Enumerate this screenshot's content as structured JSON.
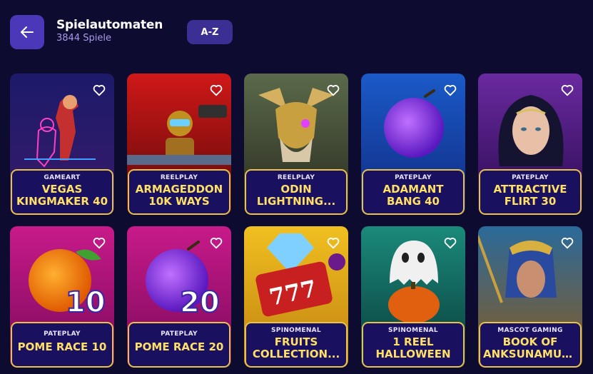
{
  "header": {
    "title": "Spielautomaten",
    "subtitle": "3844 Spiele",
    "sort_label": "A-Z",
    "back_icon": "arrow-left-icon"
  },
  "colors": {
    "background": "#0e0b30",
    "back_button": "#4a38b8",
    "sort_button": "#3b2f93",
    "label_border": "#e8c24a",
    "game_title": "#ffe066"
  },
  "games": [
    {
      "provider": "GAMEART",
      "line1": "VEGAS",
      "line2": "KINGMAKER 40",
      "art": "neon-couple"
    },
    {
      "provider": "REELPLAY",
      "line1": "ARMAGEDDON",
      "line2": "10K WAYS",
      "art": "robot"
    },
    {
      "provider": "REELPLAY",
      "line1": "ODIN",
      "line2": "LIGHTNING...",
      "art": "viking"
    },
    {
      "provider": "PATEPLAY",
      "line1": "ADAMANT",
      "line2": "BANG 40",
      "art": "plum-blue"
    },
    {
      "provider": "PATEPLAY",
      "line1": "ATTRACTIVE",
      "line2": "FLIRT 30",
      "art": "woman"
    },
    {
      "provider": "PATEPLAY",
      "line1": "POME RACE 10",
      "line2": "",
      "art": "orange"
    },
    {
      "provider": "PATEPLAY",
      "line1": "POME RACE 20",
      "line2": "",
      "art": "plum-pink"
    },
    {
      "provider": "SPINOMENAL",
      "line1": "FRUITS",
      "line2": "COLLECTION...",
      "art": "777"
    },
    {
      "provider": "SPINOMENAL",
      "line1": "1 REEL",
      "line2": "HALLOWEEN",
      "art": "ghost"
    },
    {
      "provider": "MASCOT GAMING",
      "line1": "BOOK OF",
      "line2": "ANKSUNAMUN...",
      "art": "egypt"
    }
  ],
  "badges": {
    "pome10": "10",
    "pome20": "20"
  }
}
